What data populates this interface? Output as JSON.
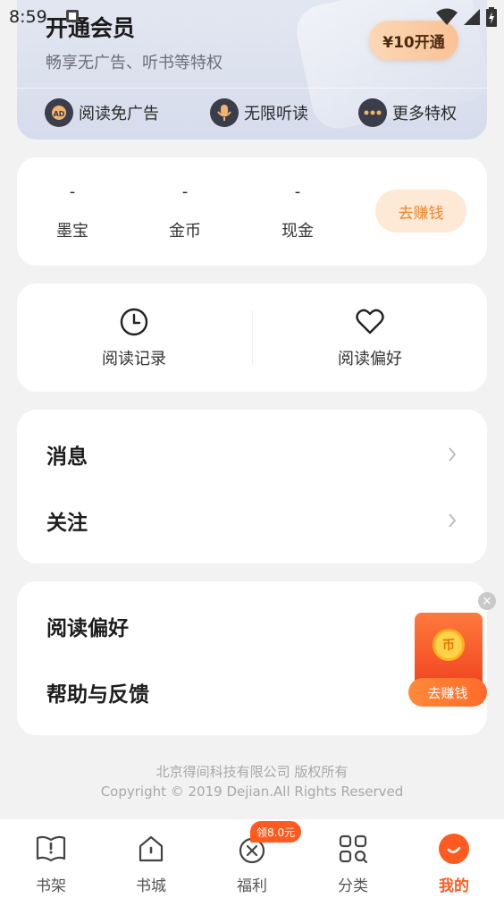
{
  "status_bar": {
    "time": "8:59"
  },
  "vip": {
    "title": "开通会员",
    "subtitle": "畅享无广告、听书等特权",
    "button_label": "¥10开通",
    "perks": [
      {
        "label": "阅读免广告",
        "icon": "ad-icon"
      },
      {
        "label": "无限听读",
        "icon": "microphone-icon"
      },
      {
        "label": "更多特权",
        "icon": "more-dots-icon"
      }
    ]
  },
  "wallet": {
    "stats": [
      {
        "value": "-",
        "label": "墨宝"
      },
      {
        "value": "-",
        "label": "金币"
      },
      {
        "value": "-",
        "label": "现金"
      }
    ],
    "earn_label": "去赚钱"
  },
  "reading": {
    "history_label": "阅读记录",
    "preference_label": "阅读偏好"
  },
  "menu1": [
    {
      "label": "消息"
    },
    {
      "label": "关注"
    }
  ],
  "menu2": [
    {
      "label": "阅读偏好"
    },
    {
      "label": "帮助与反馈"
    }
  ],
  "floating": {
    "button_label": "去赚钱",
    "close_label": "×",
    "coin_label": "币"
  },
  "footer": {
    "line1": "北京得间科技有限公司  版权所有",
    "line2": "Copyright © 2019 Dejian.All Rights Reserved"
  },
  "bottom_nav": {
    "badge": "领8.0元",
    "items": [
      {
        "label": "书架",
        "icon": "bookshelf-icon"
      },
      {
        "label": "书城",
        "icon": "home-icon"
      },
      {
        "label": "福利",
        "icon": "gift-icon"
      },
      {
        "label": "分类",
        "icon": "grid-search-icon"
      },
      {
        "label": "我的",
        "icon": "profile-icon"
      }
    ],
    "active_color": "#ff5a1f"
  }
}
